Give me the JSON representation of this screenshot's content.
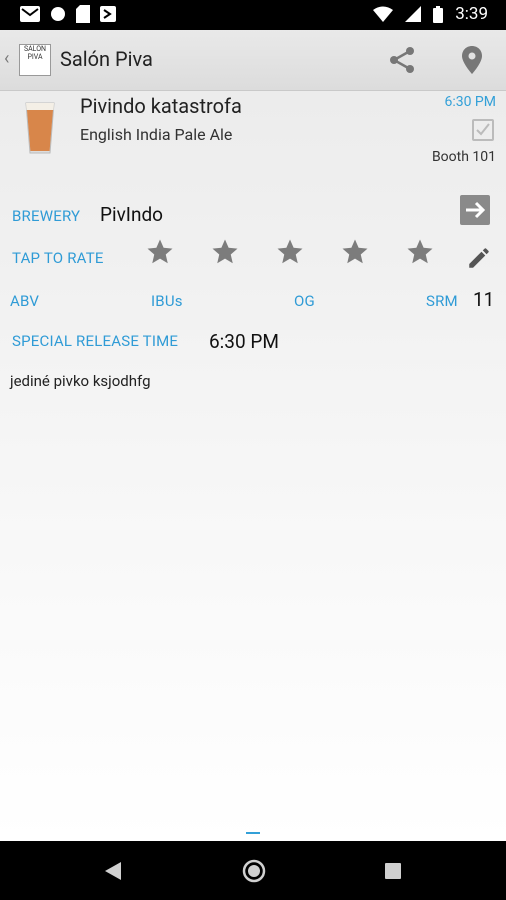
{
  "status_bar": {
    "time": "3:39"
  },
  "action_bar": {
    "app_name": "Salón Piva",
    "logo_text": "SALON PIVA"
  },
  "beer": {
    "name": "Pivindo katastrofa",
    "style": "English India Pale Ale",
    "time": "6:30 PM",
    "booth": "Booth 101"
  },
  "brewery": {
    "label": "BREWERY",
    "value": "PivIndo"
  },
  "rating": {
    "label": "TAP TO RATE",
    "stars_total": 5,
    "stars_filled": 0
  },
  "stats": {
    "abv_label": "ABV",
    "ibu_label": "IBUs",
    "og_label": "OG",
    "srm_label": "SRM",
    "srm_value": "11"
  },
  "release": {
    "label": "SPECIAL RELEASE TIME",
    "value": "6:30 PM"
  },
  "description": "jediné pivko ksjodhfg",
  "colors": {
    "accent": "#33a0d8",
    "star": "#7c7c7c"
  }
}
